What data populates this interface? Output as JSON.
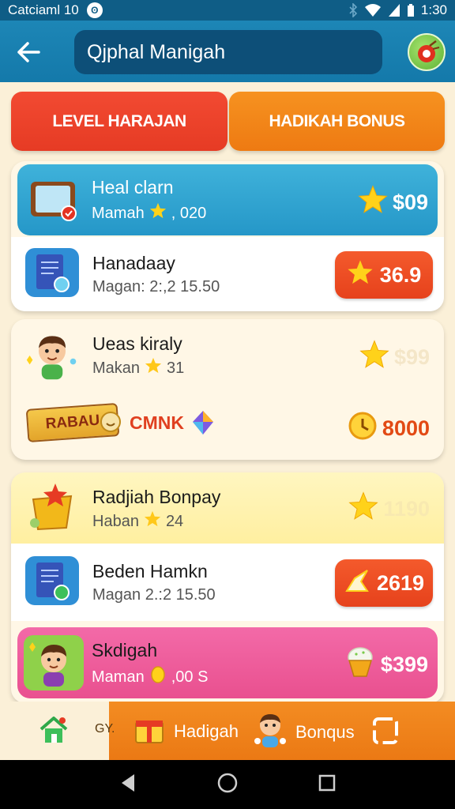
{
  "status_bar": {
    "carrier": "Catciaml 10",
    "badge": "ʘ",
    "time": "1:30"
  },
  "app_bar": {
    "title": "Qjphal Manigah",
    "back_icon": "arrow-left-icon",
    "logo_icon": "apple-target-icon"
  },
  "tabs": [
    {
      "label": "LEVEL HARAJAN"
    },
    {
      "label": "HADIKAH BONUS"
    }
  ],
  "cards": [
    {
      "rows": [
        {
          "title": "Heal clarn",
          "sub_left": "Mamah",
          "sub_right": ", 020",
          "price": "$09",
          "style": "blue-highlight"
        },
        {
          "title": "Hanadaay",
          "sub_left": "Magan: 2:,2 15.50",
          "sub_right": "",
          "price": "36.9",
          "style": "pill"
        }
      ]
    },
    {
      "rows": [
        {
          "title": "Ueas kiraly",
          "sub_left": "Makan",
          "sub_right": "31",
          "price": "$99",
          "style": "faded"
        },
        {
          "banner": "RABAU",
          "banner_right": "CMNK",
          "price": "8000",
          "style": "banner"
        }
      ]
    },
    {
      "rows": [
        {
          "title": "Radjiah Bonpay",
          "sub_left": "Haban",
          "sub_right": "24",
          "price": "1190",
          "style": "yellow-faded"
        },
        {
          "title": "Beden Hamkn",
          "sub_left": "Magan 2.:2 15.50",
          "sub_right": "",
          "price": "2619",
          "style": "pill"
        },
        {
          "title": "Skdigah",
          "sub_left": "Maman",
          "sub_right": ",00 S",
          "price": "$399",
          "style": "pink"
        }
      ]
    }
  ],
  "bottom_nav": {
    "partial_label": "GY.",
    "hadigah_label": "Hadigah",
    "bonus_label": "Bonqus"
  },
  "colors": {
    "status_bar": "#0f5d86",
    "app_bar": "#1479aa",
    "tab_level": "#e63b24",
    "tab_bonus": "#ee7a12",
    "blue_row": "#2aa3d1",
    "pink_row": "#ee5fa0",
    "yellow_row": "#fff3b0",
    "price_pill": "#e6421c",
    "background": "#fbf0d8"
  }
}
